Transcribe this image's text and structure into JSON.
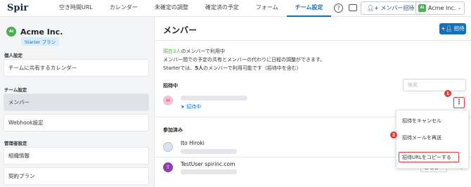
{
  "app": {
    "logo": "Spir",
    "nav_tabs": [
      "空き時間URL",
      "カレンダー",
      "未確定の調整",
      "確定済の予定",
      "フォーム",
      "チーム設定"
    ],
    "help_icon": "?",
    "invite_button": "メンバー招待",
    "org_button": "Acme Inc.",
    "org_initials": "AI"
  },
  "sidebar": {
    "org_name": "Acme Inc.",
    "org_initials": "AI",
    "plan_badge": "Starter プラン",
    "sections": [
      {
        "label": "個人設定",
        "items": [
          "チームに共有するカレンダー"
        ]
      },
      {
        "label": "チーム設定",
        "items": [
          "メンバー",
          "Webhook設定"
        ]
      },
      {
        "label": "管理者設定",
        "items": [
          "組織情報",
          "契約プラン"
        ]
      }
    ]
  },
  "main": {
    "title": "メンバー",
    "add_button": "招待",
    "info": {
      "count_text": "現在3人",
      "count_suffix": "のメンバーで利用中",
      "line2": "メンバー間での予定の共有とメンバーの代わりに日程の調整ができます。",
      "line3_prefix": "Starterでは、",
      "line3_bold": "5人",
      "line3_suffix": "のメンバーで利用可能です（招待中を含む）"
    },
    "pending": {
      "heading": "招待中",
      "search_placeholder": "検索",
      "avatar_letter": "H",
      "status": "招待中"
    },
    "joined": {
      "heading": "参加済み",
      "members": [
        {
          "name": "Ito Hiroki"
        },
        {
          "name": "TestUser spirinc.com",
          "avatar_letter": "T",
          "role": "管理者"
        }
      ]
    },
    "menu_items": [
      "招待をキャンセル",
      "招待メールを再送",
      "招待URLをコピーする"
    ],
    "step_badges": [
      "1",
      "2"
    ]
  },
  "colors": {
    "accent": "#1670b8",
    "highlight": "#e53935",
    "green": "#4caf50"
  }
}
